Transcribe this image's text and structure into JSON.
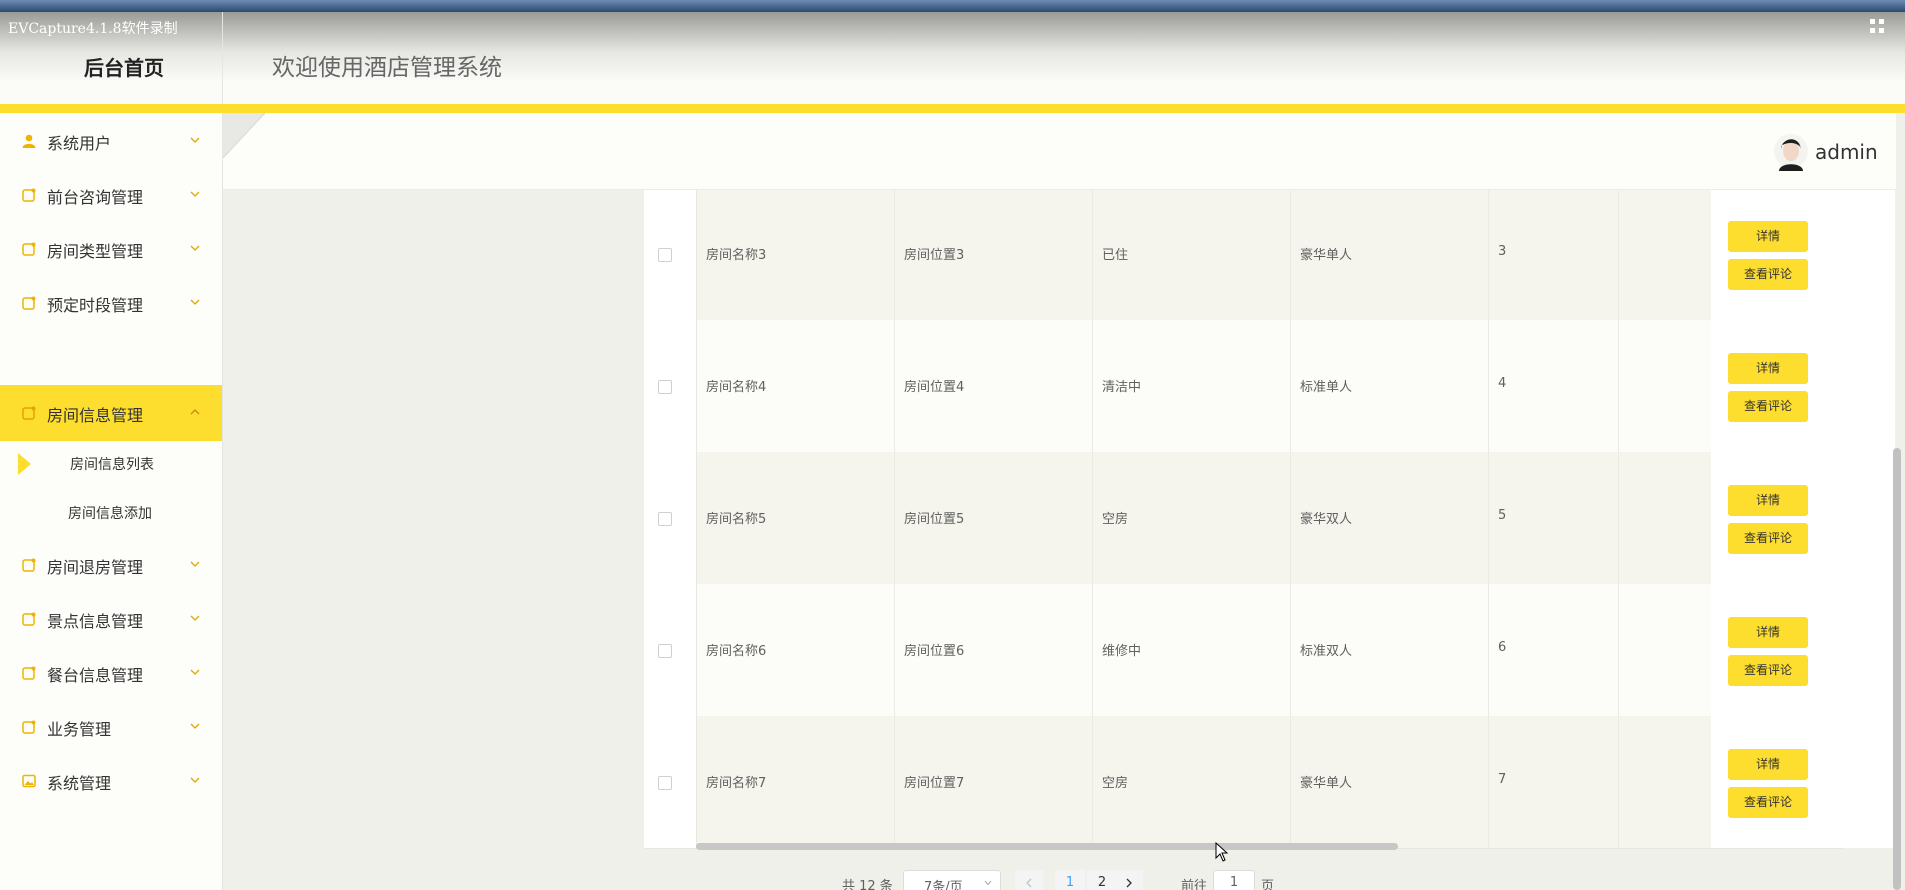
{
  "recorder": {
    "label": "EVCapture4.1.8软件录制"
  },
  "header": {
    "brand": "后台首页",
    "welcome": "欢迎使用酒店管理系统"
  },
  "user": {
    "name": "admin"
  },
  "sidebar": {
    "items": [
      {
        "label": "系统用户",
        "icon": "user-icon"
      },
      {
        "label": "前台咨询管理",
        "icon": "edit-icon"
      },
      {
        "label": "房间类型管理",
        "icon": "edit-icon"
      },
      {
        "label": "预定时段管理",
        "icon": "edit-icon"
      },
      {
        "label": "房间信息管理",
        "icon": "edit-icon",
        "active": true
      },
      {
        "label": "房间退房管理",
        "icon": "edit-icon"
      },
      {
        "label": "景点信息管理",
        "icon": "edit-icon"
      },
      {
        "label": "餐台信息管理",
        "icon": "edit-icon"
      },
      {
        "label": "业务管理",
        "icon": "edit-icon"
      },
      {
        "label": "系统管理",
        "icon": "image-icon"
      }
    ],
    "sub_items": [
      {
        "label": "房间信息列表",
        "selected": true
      },
      {
        "label": "房间信息添加"
      }
    ]
  },
  "table": {
    "rows": [
      {
        "name": "房间名称3",
        "location": "房间位置3",
        "status": "已住",
        "type": "豪华单人",
        "number": "3"
      },
      {
        "name": "房间名称4",
        "location": "房间位置4",
        "status": "清洁中",
        "type": "标准单人",
        "number": "4"
      },
      {
        "name": "房间名称5",
        "location": "房间位置5",
        "status": "空房",
        "type": "豪华双人",
        "number": "5"
      },
      {
        "name": "房间名称6",
        "location": "房间位置6",
        "status": "维修中",
        "type": "标准双人",
        "number": "6"
      },
      {
        "name": "房间名称7",
        "location": "房间位置7",
        "status": "空房",
        "type": "豪华单人",
        "number": "7"
      }
    ],
    "detail_label": "详情",
    "comment_label": "查看评论"
  },
  "pagination": {
    "total": "共 12 条",
    "page_size": "7条/页",
    "pages": [
      "1",
      "2"
    ],
    "current": "1",
    "goto_label": "前往",
    "goto_value": "1",
    "goto_unit": "页"
  },
  "colors": {
    "accent": "#fddd2d",
    "link": "#409eff"
  }
}
